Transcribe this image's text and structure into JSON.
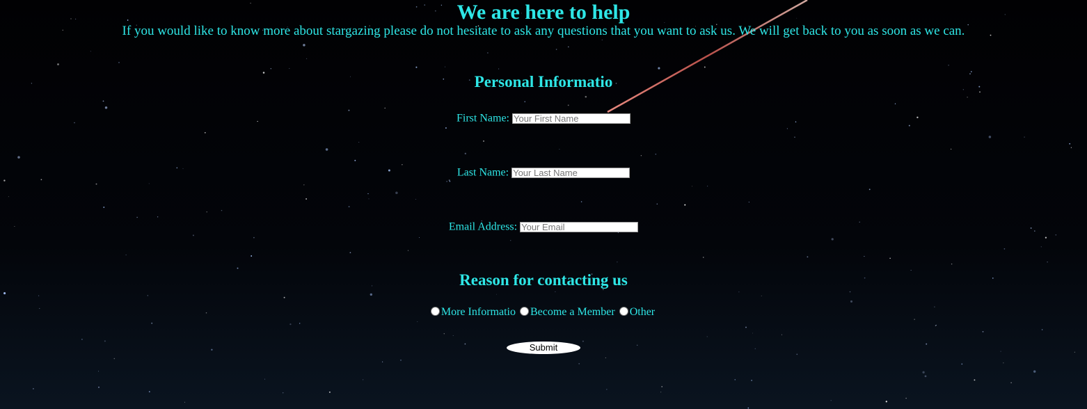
{
  "header": {
    "title": "We are here to help",
    "intro": "If you would like to know more about stargazing please do not hesitate to ask any questions that you want to ask us. We will get back to you as soon as we can."
  },
  "personal": {
    "heading": "Personal Informatio",
    "first_name": {
      "label": "First Name:",
      "value": "",
      "placeholder": "Your First Name"
    },
    "last_name": {
      "label": "Last Name:",
      "value": "",
      "placeholder": "Your Last Name"
    },
    "email": {
      "label": "Email Address:",
      "value": "",
      "placeholder": "Your Email"
    }
  },
  "reason": {
    "heading": "Reason for contacting us",
    "options": [
      {
        "label": "More Informatio",
        "checked": false
      },
      {
        "label": "Become a Member",
        "checked": false
      },
      {
        "label": "Other",
        "checked": false
      }
    ]
  },
  "submit": {
    "label": "Submit"
  },
  "colors": {
    "text_accent": "#2ee6e6",
    "background": "#020205",
    "meteor": "#c8605a"
  },
  "background_image": "night-sky-with-stars-and-meteor"
}
